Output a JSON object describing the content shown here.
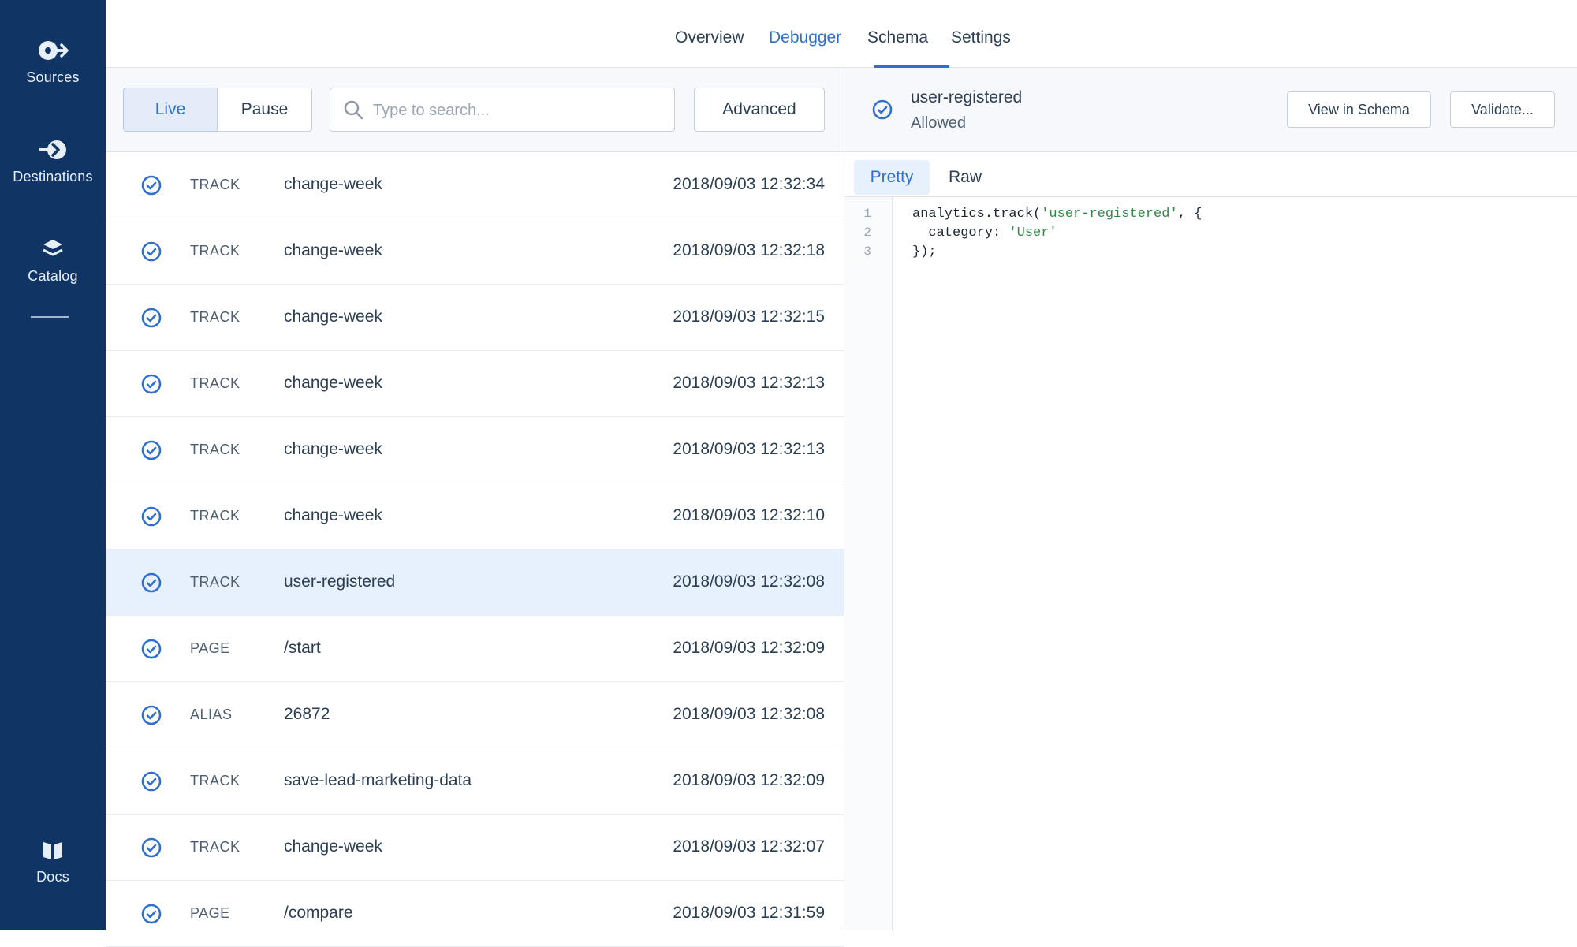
{
  "sidebar": {
    "items": [
      {
        "label": "Sources",
        "icon": "sources-icon"
      },
      {
        "label": "Destinations",
        "icon": "destinations-icon"
      },
      {
        "label": "Catalog",
        "icon": "catalog-icon"
      },
      {
        "label": "Docs",
        "icon": "docs-icon"
      }
    ]
  },
  "top_tabs": {
    "items": [
      {
        "label": "Overview"
      },
      {
        "label": "Debugger",
        "active": true
      },
      {
        "label": "Schema"
      },
      {
        "label": "Settings"
      }
    ]
  },
  "toolbar": {
    "live_label": "Live",
    "pause_label": "Pause",
    "search_placeholder": "Type to search...",
    "advanced_label": "Advanced"
  },
  "events": [
    {
      "type": "TRACK",
      "name": "change-week",
      "time": "2018/09/03 12:32:34"
    },
    {
      "type": "TRACK",
      "name": "change-week",
      "time": "2018/09/03 12:32:18"
    },
    {
      "type": "TRACK",
      "name": "change-week",
      "time": "2018/09/03 12:32:15"
    },
    {
      "type": "TRACK",
      "name": "change-week",
      "time": "2018/09/03 12:32:13"
    },
    {
      "type": "TRACK",
      "name": "change-week",
      "time": "2018/09/03 12:32:13"
    },
    {
      "type": "TRACK",
      "name": "change-week",
      "time": "2018/09/03 12:32:10"
    },
    {
      "type": "TRACK",
      "name": "user-registered",
      "time": "2018/09/03 12:32:08",
      "selected": true
    },
    {
      "type": "PAGE",
      "name": "/start",
      "time": "2018/09/03 12:32:09"
    },
    {
      "type": "ALIAS",
      "name": "26872",
      "time": "2018/09/03 12:32:08"
    },
    {
      "type": "TRACK",
      "name": "save-lead-marketing-data",
      "time": "2018/09/03 12:32:09"
    },
    {
      "type": "TRACK",
      "name": "change-week",
      "time": "2018/09/03 12:32:07"
    },
    {
      "type": "PAGE",
      "name": "/compare",
      "time": "2018/09/03 12:31:59"
    }
  ],
  "detail": {
    "title": "user-registered",
    "status": "Allowed",
    "view_in_schema_label": "View in Schema",
    "validate_label": "Validate...",
    "tabs": {
      "pretty": "Pretty",
      "raw": "Raw"
    },
    "code": {
      "line_numbers": [
        "1",
        "2",
        "3"
      ],
      "line1_prefix": "analytics.track(",
      "line1_string": "'user-registered'",
      "line1_suffix": ", {",
      "line2_prefix": "  category: ",
      "line2_string": "'User'",
      "line3": "});"
    }
  },
  "colors": {
    "sidebar_bg": "#103565",
    "accent": "#2e6fd0",
    "selected_row_bg": "#e7f1fd",
    "code_string": "#2f8a45"
  }
}
